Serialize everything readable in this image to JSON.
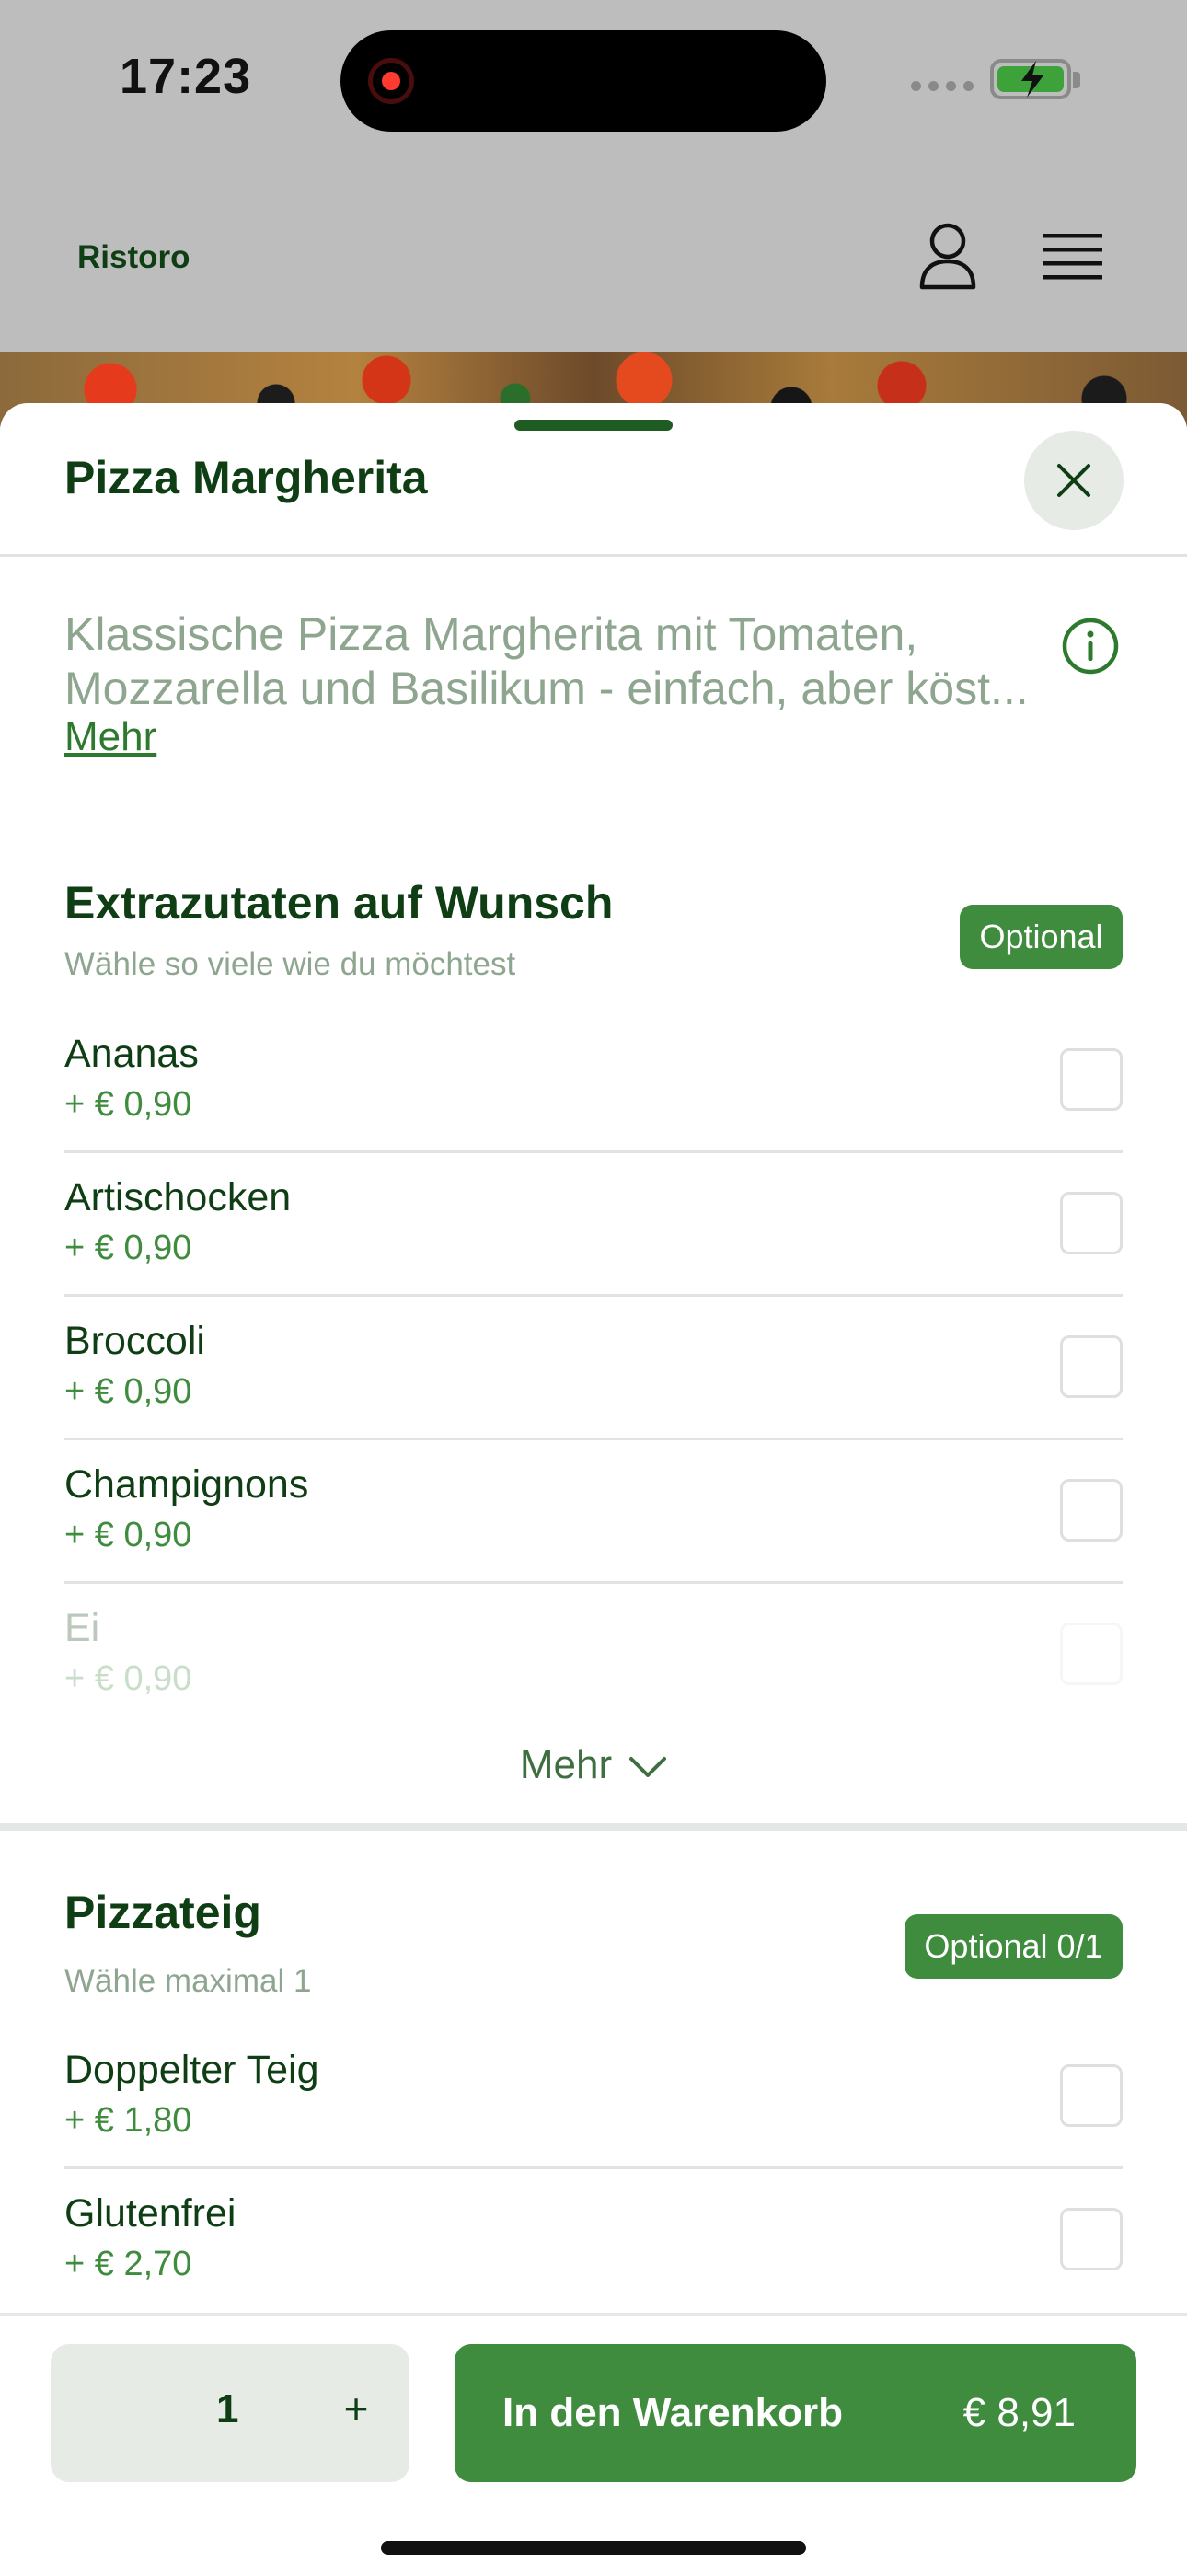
{
  "status_bar": {
    "time": "17:23"
  },
  "header": {
    "brand": "Ristoro"
  },
  "sheet": {
    "title": "Pizza Margherita",
    "description_lines": [
      "Klassische Pizza Margherita mit Tomaten,",
      "Mozzarella und Basilikum - einfach, aber köst..."
    ],
    "description_more": "Mehr"
  },
  "extras": {
    "title": "Extrazutaten auf Wunsch",
    "subtitle": "Wähle so viele wie du möchtest",
    "badge": "Optional",
    "options": [
      {
        "name": "Ananas",
        "price": "+ € 0,90",
        "checked": false
      },
      {
        "name": "Artischocken",
        "price": "+ € 0,90",
        "checked": false
      },
      {
        "name": "Broccoli",
        "price": "+ € 0,90",
        "checked": false
      },
      {
        "name": "Champignons",
        "price": "+ € 0,90",
        "checked": false
      },
      {
        "name": "Ei",
        "price": "+ € 0,90",
        "checked": false
      }
    ],
    "more_label": "Mehr"
  },
  "dough": {
    "title": "Pizzateig",
    "subtitle": "Wähle maximal 1",
    "badge": "Optional 0/1",
    "options": [
      {
        "name": "Doppelter Teig",
        "price": "+ € 1,80",
        "checked": false
      },
      {
        "name": "Glutenfrei",
        "price": "+ € 2,70",
        "checked": false
      }
    ]
  },
  "footer": {
    "quantity": "1",
    "plus_label": "+",
    "cart_label": "In den Warenkorb",
    "cart_price": "€ 8,91"
  },
  "colors": {
    "primary": "#3f8c3f",
    "text_dark_green": "#0f3d14",
    "muted_green": "#8ea58f",
    "overlay_gray": "#bdbdbd"
  },
  "icons": [
    "user-icon",
    "menu-icon",
    "close-icon",
    "info-icon",
    "chevron-down-icon"
  ]
}
